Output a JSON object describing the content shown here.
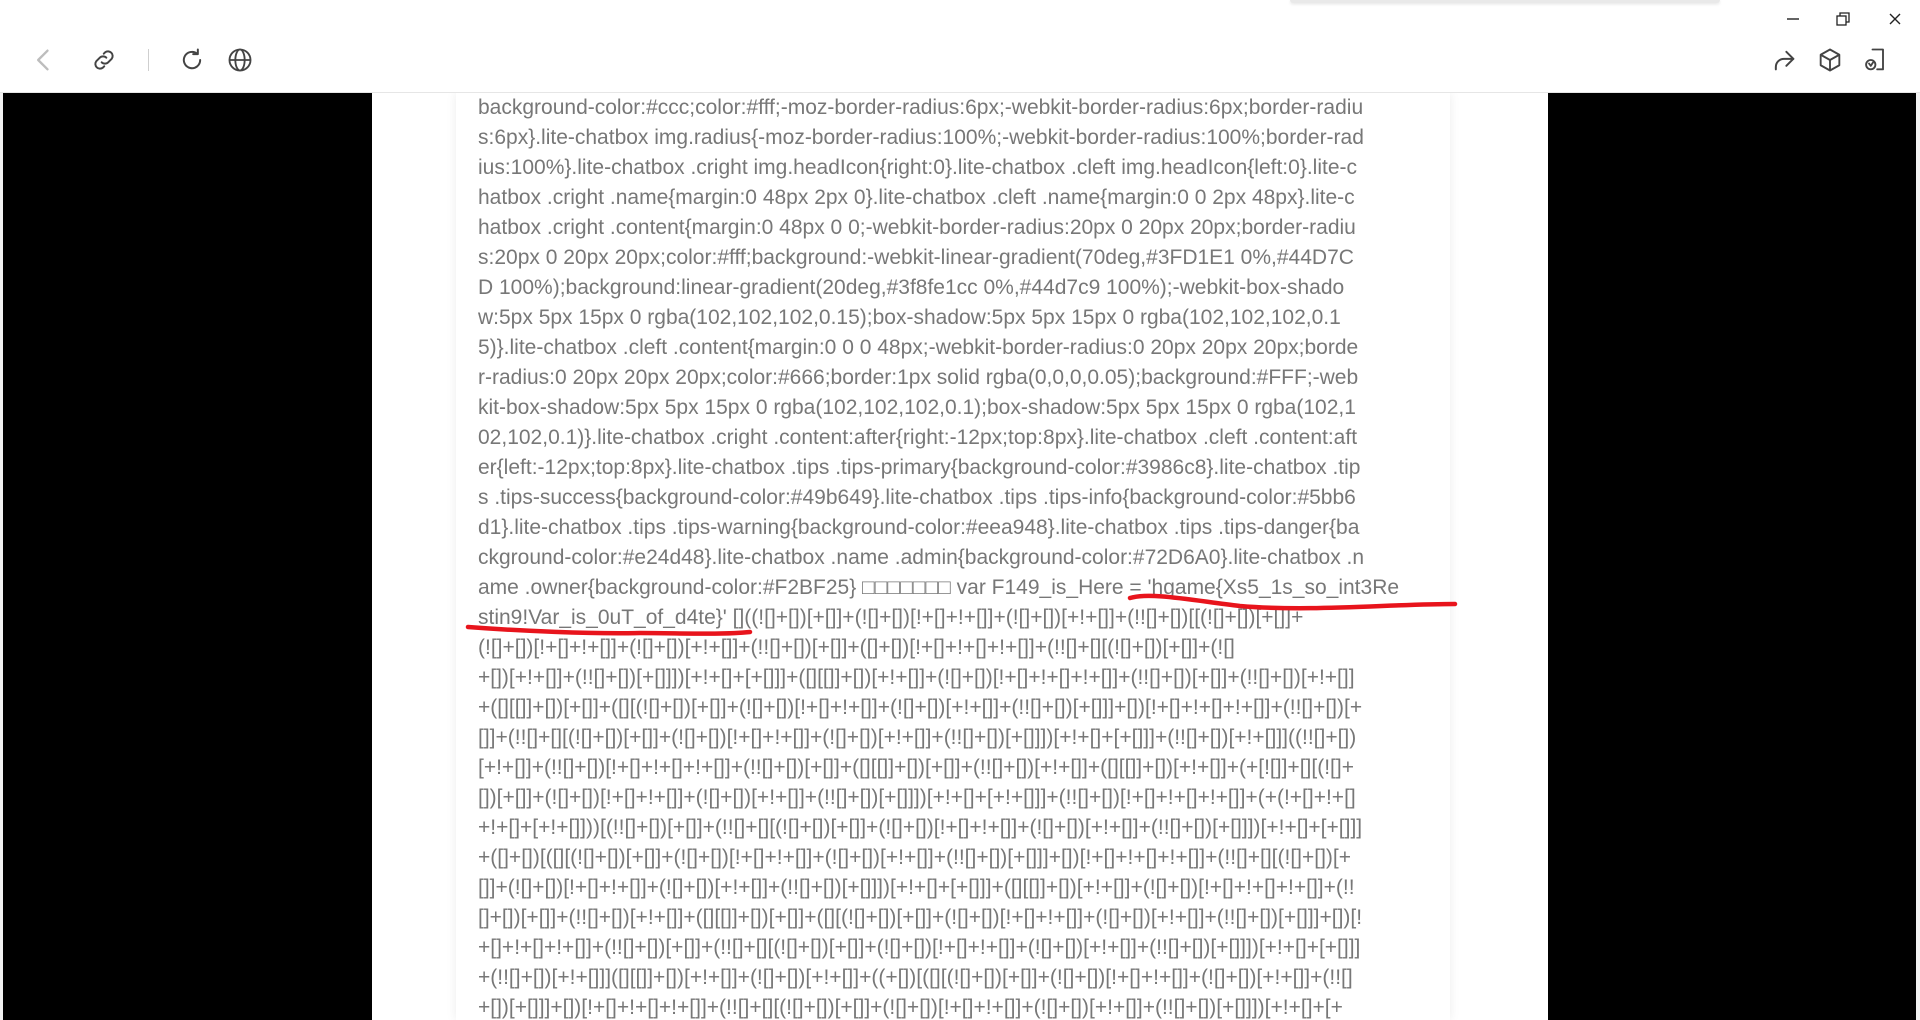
{
  "toolbar": {
    "icons": [
      "back-arrow-icon",
      "link-icon",
      "refresh-icon",
      "globe-icon",
      "share-icon",
      "cube-icon",
      "reader-mode-icon"
    ]
  },
  "window_controls": [
    "minimize-icon",
    "restore-icon",
    "close-icon"
  ],
  "document": {
    "lines": [
      "background-color:#ccc;color:#fff;-moz-border-radius:6px;-webkit-border-radius:6px;border-radiu",
      "s:6px}.lite-chatbox img.radius{-moz-border-radius:100%;-webkit-border-radius:100%;border-rad",
      "ius:100%}.lite-chatbox .cright img.headIcon{right:0}.lite-chatbox .cleft img.headIcon{left:0}.lite-c",
      "hatbox .cright .name{margin:0 48px 2px 0}.lite-chatbox .cleft .name{margin:0 0 2px 48px}.lite-c",
      "hatbox .cright .content{margin:0 48px 0 0;-webkit-border-radius:20px 0 20px 20px;border-radiu",
      "s:20px 0 20px 20px;color:#fff;background:-webkit-linear-gradient(70deg,#3FD1E1 0%,#44D7C",
      "D 100%);background:linear-gradient(20deg,#3f8fe1cc 0%,#44d7c9 100%);-webkit-box-shado",
      "w:5px 5px 15px 0 rgba(102,102,102,0.15);box-shadow:5px 5px 15px 0 rgba(102,102,102,0.1",
      "5)}.lite-chatbox .cleft .content{margin:0 0 0 48px;-webkit-border-radius:0 20px 20px 20px;borde",
      "r-radius:0 20px 20px 20px;color:#666;border:1px solid rgba(0,0,0,0.05);background:#FFF;-web",
      "kit-box-shadow:5px 5px 15px 0 rgba(102,102,102,0.1);box-shadow:5px 5px 15px 0 rgba(102,1",
      "02,102,0.1)}.lite-chatbox .cright .content:after{right:-12px;top:8px}.lite-chatbox .cleft .content:aft",
      "er{left:-12px;top:8px}.lite-chatbox .tips .tips-primary{background-color:#3986c8}.lite-chatbox .tip",
      "s .tips-success{background-color:#49b649}.lite-chatbox .tips .tips-info{background-color:#5bb6",
      "d1}.lite-chatbox .tips .tips-warning{background-color:#eea948}.lite-chatbox .tips .tips-danger{ba",
      "ckground-color:#e24d48}.lite-chatbox .name .admin{background-color:#72D6A0}.lite-chatbox .n",
      "ame .owner{background-color:#F2BF25} □□□□□□□ var F149_is_Here = 'hgame{Xs5_1s_so_int3Re",
      "stin9!Var_is_0uT_of_d4te}' []((![]+[])[+[]]+(![]+[])[!+[]+!+[]]+(![]+[])[+!+[]]+(!![]+[])[[(![]+[])[+[]]+",
      "(![]+[])[!+[]+!+[]]+(![]+[])[+!+[]]+(!![]+[])[+[]]+([]+[])[!+[]+!+[]+!+[]]+(!![]+[][(![]+[])[+[]]+(![]",
      "+[])[+!+[]]+(!![]+[])[+[]]])[+!+[]+[+[]]]+([][[]]+[])[+!+[]]+(![]+[])[!+[]+!+[]+!+[]]+(!![]+[])[+[]]+(!![]+[])[+!+[]]",
      "+([][[]]+[])[+[]]+([][(![]+[])[+[]]+(![]+[])[!+[]+!+[]]+(![]+[])[+!+[]]+(!![]+[])[+[]]]+[])[!+[]+!+[]+!+[]]+(!![]+[])[+",
      "[]]+(!![]+[][(![]+[])[+[]]+(![]+[])[!+[]+!+[]]+(![]+[])[+!+[]]+(!![]+[])[+[]]])[+!+[]+[+[]]]+(!![]+[])[+!+[]]]((!![]+[])",
      "[+!+[]]+(!![]+[])[!+[]+!+[]+!+[]]+(!![]+[])[+[]]+([][[]]+[])[+[]]+(!![]+[])[+!+[]]+([][[]]+[])[+!+[]]+(+[![]]+[][(![]+",
      "[])[+[]]+(![]+[])[!+[]+!+[]]+(![]+[])[+!+[]]+(!![]+[])[+[]]])[+!+[]+[+!+[]]]+(!![]+[])[!+[]+!+[]+!+[]]+(+(!+[]+!+[]",
      "+!+[]+[+!+[]]))[(!![]+[])[+[]]+(!![]+[][(![]+[])[+[]]+(![]+[])[!+[]+!+[]]+(![]+[])[+!+[]]+(!![]+[])[+[]]])[+!+[]+[+[]]]",
      "+([]+[])[([][(![]+[])[+[]]+(![]+[])[!+[]+!+[]]+(![]+[])[+!+[]]+(!![]+[])[+[]]]+[])[!+[]+!+[]+!+[]]+(!![]+[][(![]+[])[+",
      "[]]+(![]+[])[!+[]+!+[]]+(![]+[])[+!+[]]+(!![]+[])[+[]]])[+!+[]+[+[]]]+([][[]]+[])[+!+[]]+(![]+[])[!+[]+!+[]+!+[]]+(!!",
      "[]+[])[+[]]+(!![]+[])[+!+[]]+([][[]]+[])[+[]]+([][(![]+[])[+[]]+(![]+[])[!+[]+!+[]]+(![]+[])[+!+[]]+(!![]+[])[+[]]]+[])[!",
      "+[]+!+[]+!+[]]+(!![]+[])[+[]]+(!![]+[][(![]+[])[+[]]+(![]+[])[!+[]+!+[]]+(![]+[])[+!+[]]+(!![]+[])[+[]]])[+!+[]+[+[]]]",
      "+(!![]+[])[+!+[]]]([][[]]+[])[+!+[]]+(![]+[])[+!+[]]+((+[])[([][(![]+[])[+[]]+(![]+[])[!+[]+!+[]]+(![]+[])[+!+[]]+(!![]",
      "+[])[+[]]]+[])[!+[]+!+[]+!+[]]+(!![]+[][(![]+[])[+[]]+(![]+[])[!+[]+!+[]]+(![]+[])[+!+[]]+(!![]+[])[+[]]])[+!+[]+[+"
    ]
  }
}
